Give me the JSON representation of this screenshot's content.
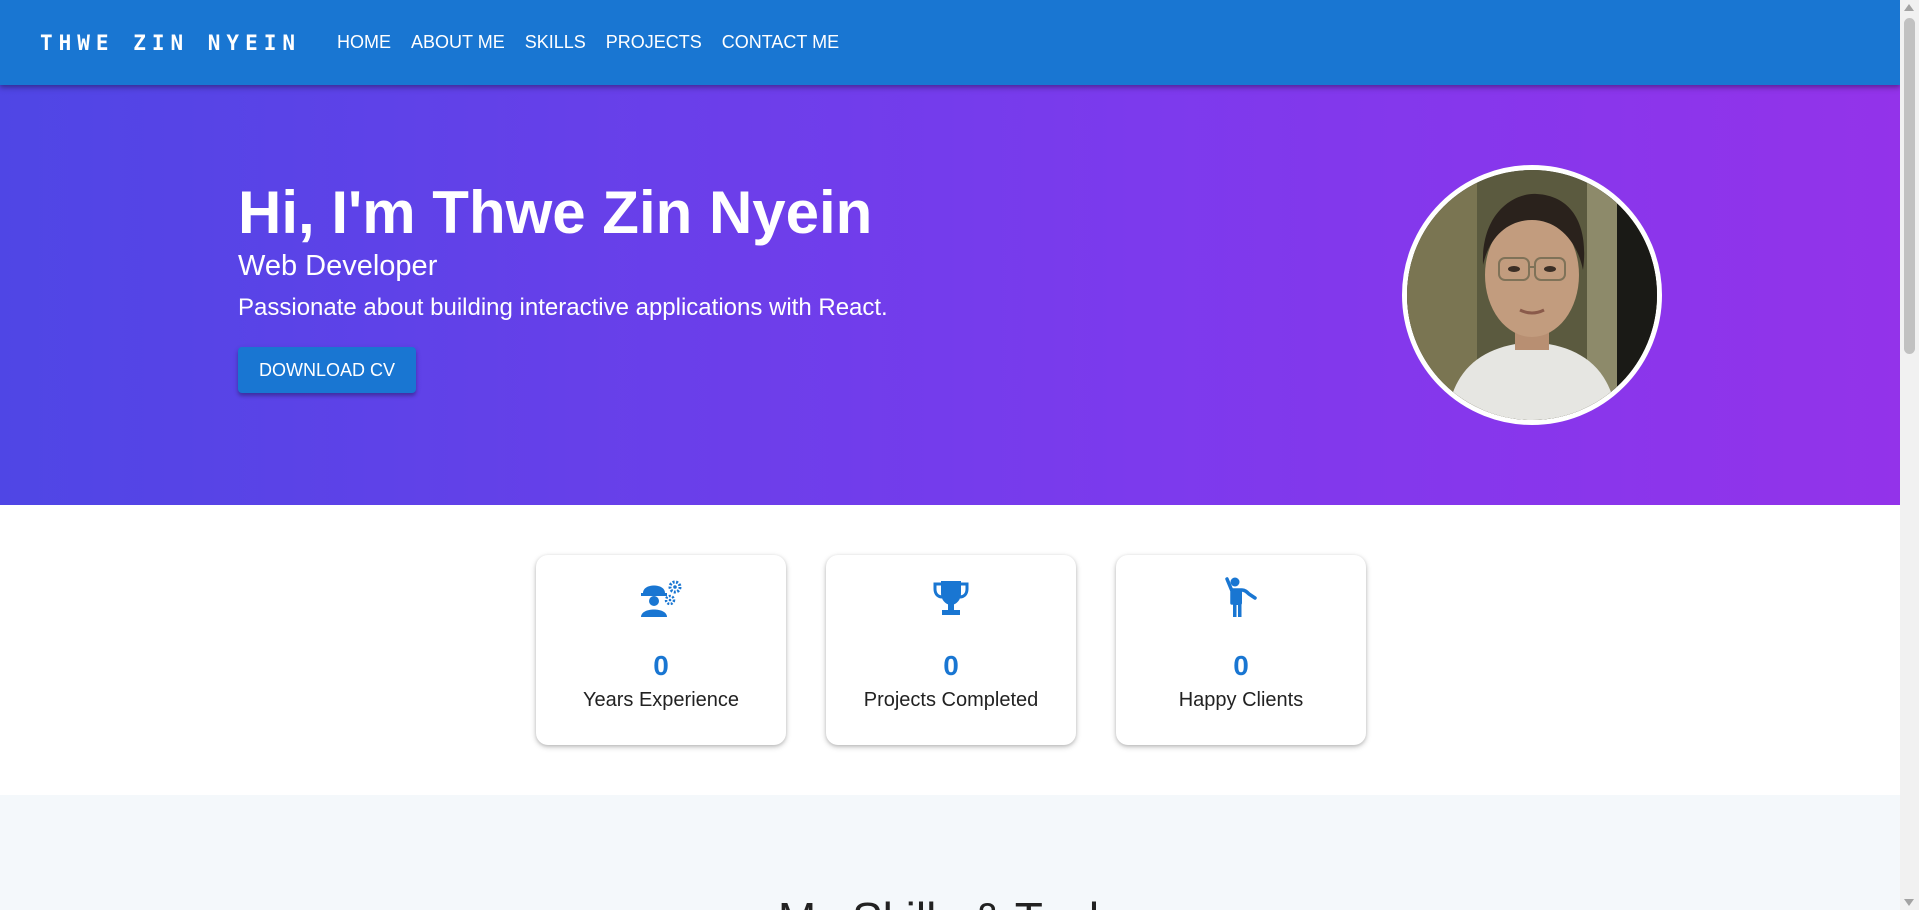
{
  "header": {
    "brand": "THWE ZIN NYEIN",
    "nav": [
      "HOME",
      "ABOUT ME",
      "SKILLS",
      "PROJECTS",
      "CONTACT ME"
    ]
  },
  "hero": {
    "title": "Hi, I'm Thwe Zin Nyein",
    "subtitle": "Web Developer",
    "tagline": "Passionate about building interactive applications with React.",
    "cv_button": "DOWNLOAD CV"
  },
  "stats": [
    {
      "icon": "engineer-icon",
      "value": "0",
      "label": "Years Experience"
    },
    {
      "icon": "trophy-icon",
      "value": "0",
      "label": "Projects Completed"
    },
    {
      "icon": "person-waving-icon",
      "value": "0",
      "label": "Happy Clients"
    }
  ],
  "skills": {
    "heading": "My Skills & Tools"
  },
  "colors": {
    "primary": "#1976d2",
    "hero_gradient_start": "#4f46e5",
    "hero_gradient_end": "#9333ea",
    "skills_bg": "#f4f8fb"
  }
}
